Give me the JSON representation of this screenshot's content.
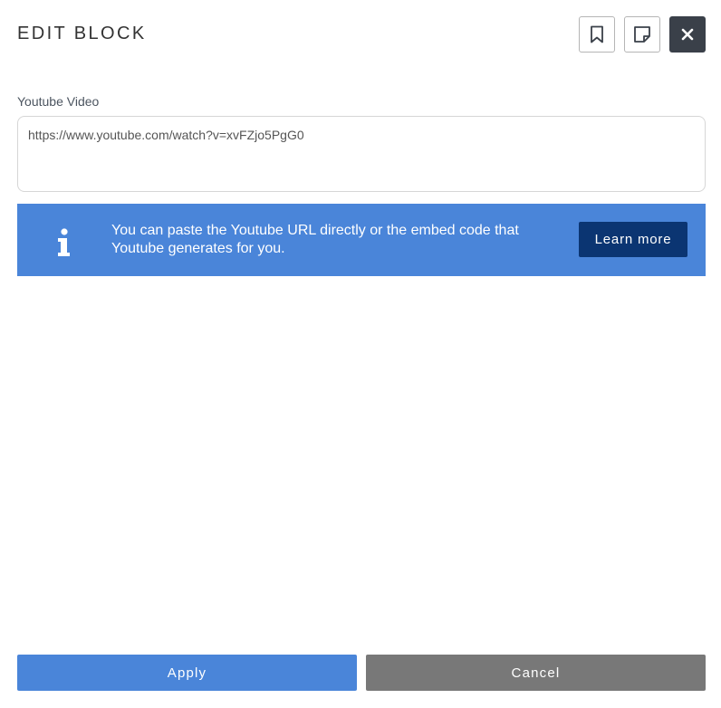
{
  "header": {
    "title": "EDIT BLOCK",
    "buttons": [
      {
        "icon": "bookmark-icon"
      },
      {
        "icon": "note-icon"
      },
      {
        "icon": "close-icon"
      }
    ]
  },
  "field": {
    "label": "Youtube Video",
    "value": "https://www.youtube.com/watch?v=xvFZjo5PgG0"
  },
  "info": {
    "icon": "info-icon",
    "text": "You can paste the Youtube URL directly or the embed code that Youtube generates for you.",
    "button_label": "Learn more"
  },
  "footer": {
    "apply_label": "Apply",
    "cancel_label": "Cancel"
  },
  "colors": {
    "primary": "#4a85d9",
    "dark_button": "#3a4049",
    "learn_more_bg": "#0b3572",
    "cancel_bg": "#787878"
  }
}
